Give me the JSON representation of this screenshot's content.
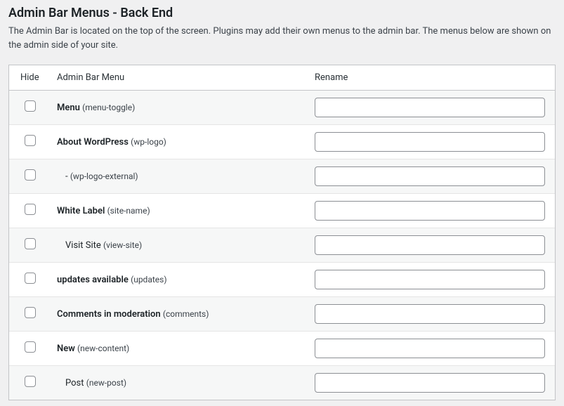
{
  "header": {
    "title": "Admin Bar Menus - Back End",
    "description": "The Admin Bar is located on the top of the screen. Plugins may add their own menus to the admin bar. The menus below are shown on the admin side of your site."
  },
  "columns": {
    "hide": "Hide",
    "menu": "Admin Bar Menu",
    "rename": "Rename"
  },
  "rows": [
    {
      "label": "Menu",
      "slug": "(menu-toggle)",
      "bold": true,
      "indent": false,
      "rename": ""
    },
    {
      "label": "About WordPress",
      "slug": "(wp-logo)",
      "bold": true,
      "indent": false,
      "rename": ""
    },
    {
      "label": "-",
      "slug": "(wp-logo-external)",
      "bold": false,
      "indent": true,
      "rename": ""
    },
    {
      "label": "White Label",
      "slug": "(site-name)",
      "bold": true,
      "indent": false,
      "rename": ""
    },
    {
      "label": "Visit Site",
      "slug": "(view-site)",
      "bold": false,
      "indent": true,
      "rename": ""
    },
    {
      "label": "updates available",
      "slug": "(updates)",
      "bold": true,
      "indent": false,
      "rename": ""
    },
    {
      "label": "Comments in moderation",
      "slug": "(comments)",
      "bold": true,
      "indent": false,
      "rename": ""
    },
    {
      "label": "New",
      "slug": "(new-content)",
      "bold": true,
      "indent": false,
      "rename": ""
    },
    {
      "label": "Post",
      "slug": "(new-post)",
      "bold": false,
      "indent": true,
      "rename": ""
    }
  ]
}
